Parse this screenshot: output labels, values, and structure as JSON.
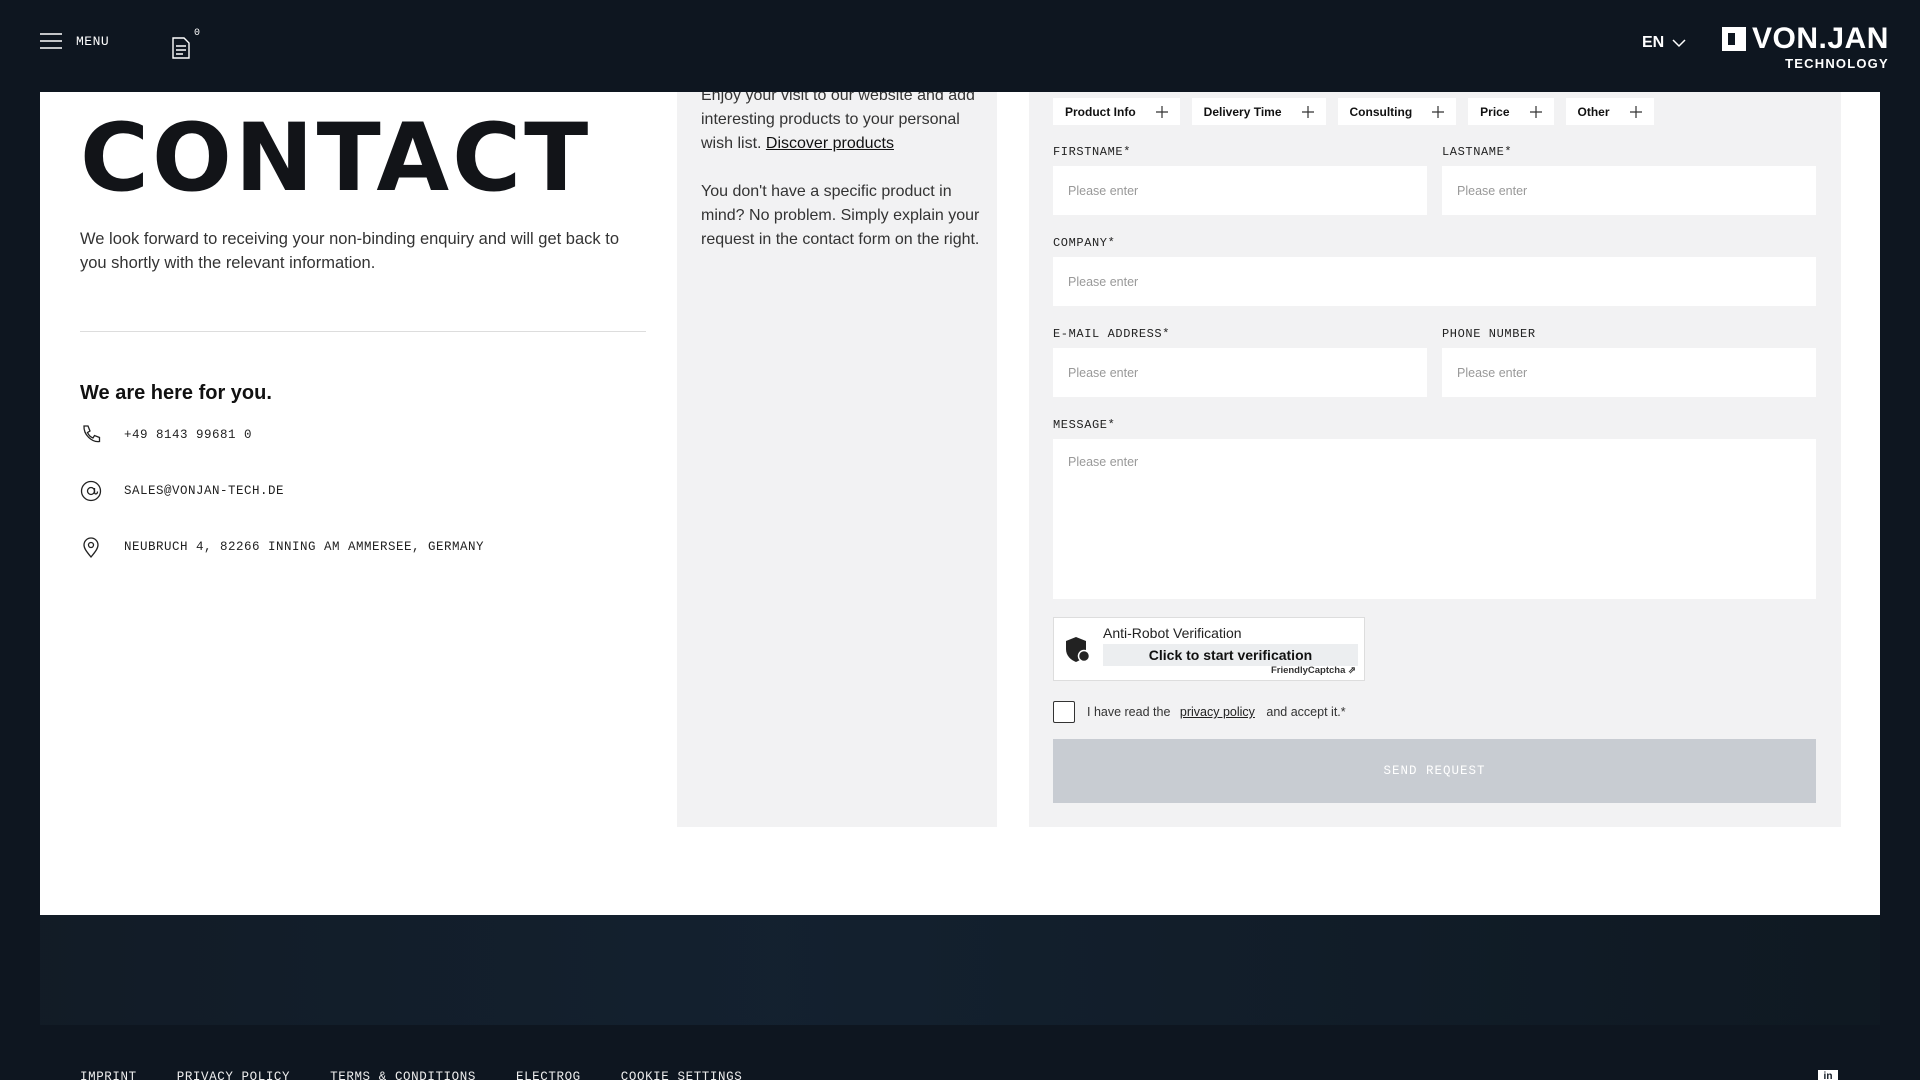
{
  "header": {
    "menu_label": "MENU",
    "wishlist_count": "0",
    "language": "EN",
    "logo_main": "VON.JAN",
    "logo_sub": "TECHNOLOGY"
  },
  "intro": {
    "title": "CONTACT",
    "text": "We look forward to receiving your non-binding enquiry and will get back to you shortly with the relevant information.",
    "here_title": "We are here for you.",
    "phone": "+49 8143 99681 0",
    "email": "SALES@VONJAN-TECH.DE",
    "address": "NEUBRUCH 4, 82266 INNING AM AMMERSEE, GERMANY"
  },
  "middle": {
    "p1_text": "Enjoy your visit to our website and add interesting products to your personal wish list.",
    "p1_link": "Discover products",
    "p2_text": "You don't have a specific product in mind? No problem. Simply explain your request in the contact form on the right."
  },
  "form": {
    "topics": [
      "Product Info",
      "Delivery Time",
      "Consulting",
      "Price",
      "Other"
    ],
    "firstname_label": "FIRSTNAME*",
    "lastname_label": "LASTNAME*",
    "company_label": "COMPANY*",
    "email_label": "E-MAIL ADDRESS*",
    "phone_label": "PHONE NUMBER",
    "message_label": "MESSAGE*",
    "placeholder": "Please enter",
    "captcha_title": "Anti-Robot Verification",
    "captcha_button": "Click to start verification",
    "captcha_brand": "FriendlyCaptcha ⇗",
    "privacy_prefix": "I have read the",
    "privacy_link": "privacy policy",
    "privacy_suffix": "and accept it.*",
    "send_label": "SEND REQUEST"
  },
  "footer": {
    "links": [
      "IMPRINT",
      "PRIVACY POLICY",
      "TERMS & CONDITIONS",
      "ELECTROG",
      "COOKIE SETTINGS"
    ],
    "linkedin": "in"
  }
}
